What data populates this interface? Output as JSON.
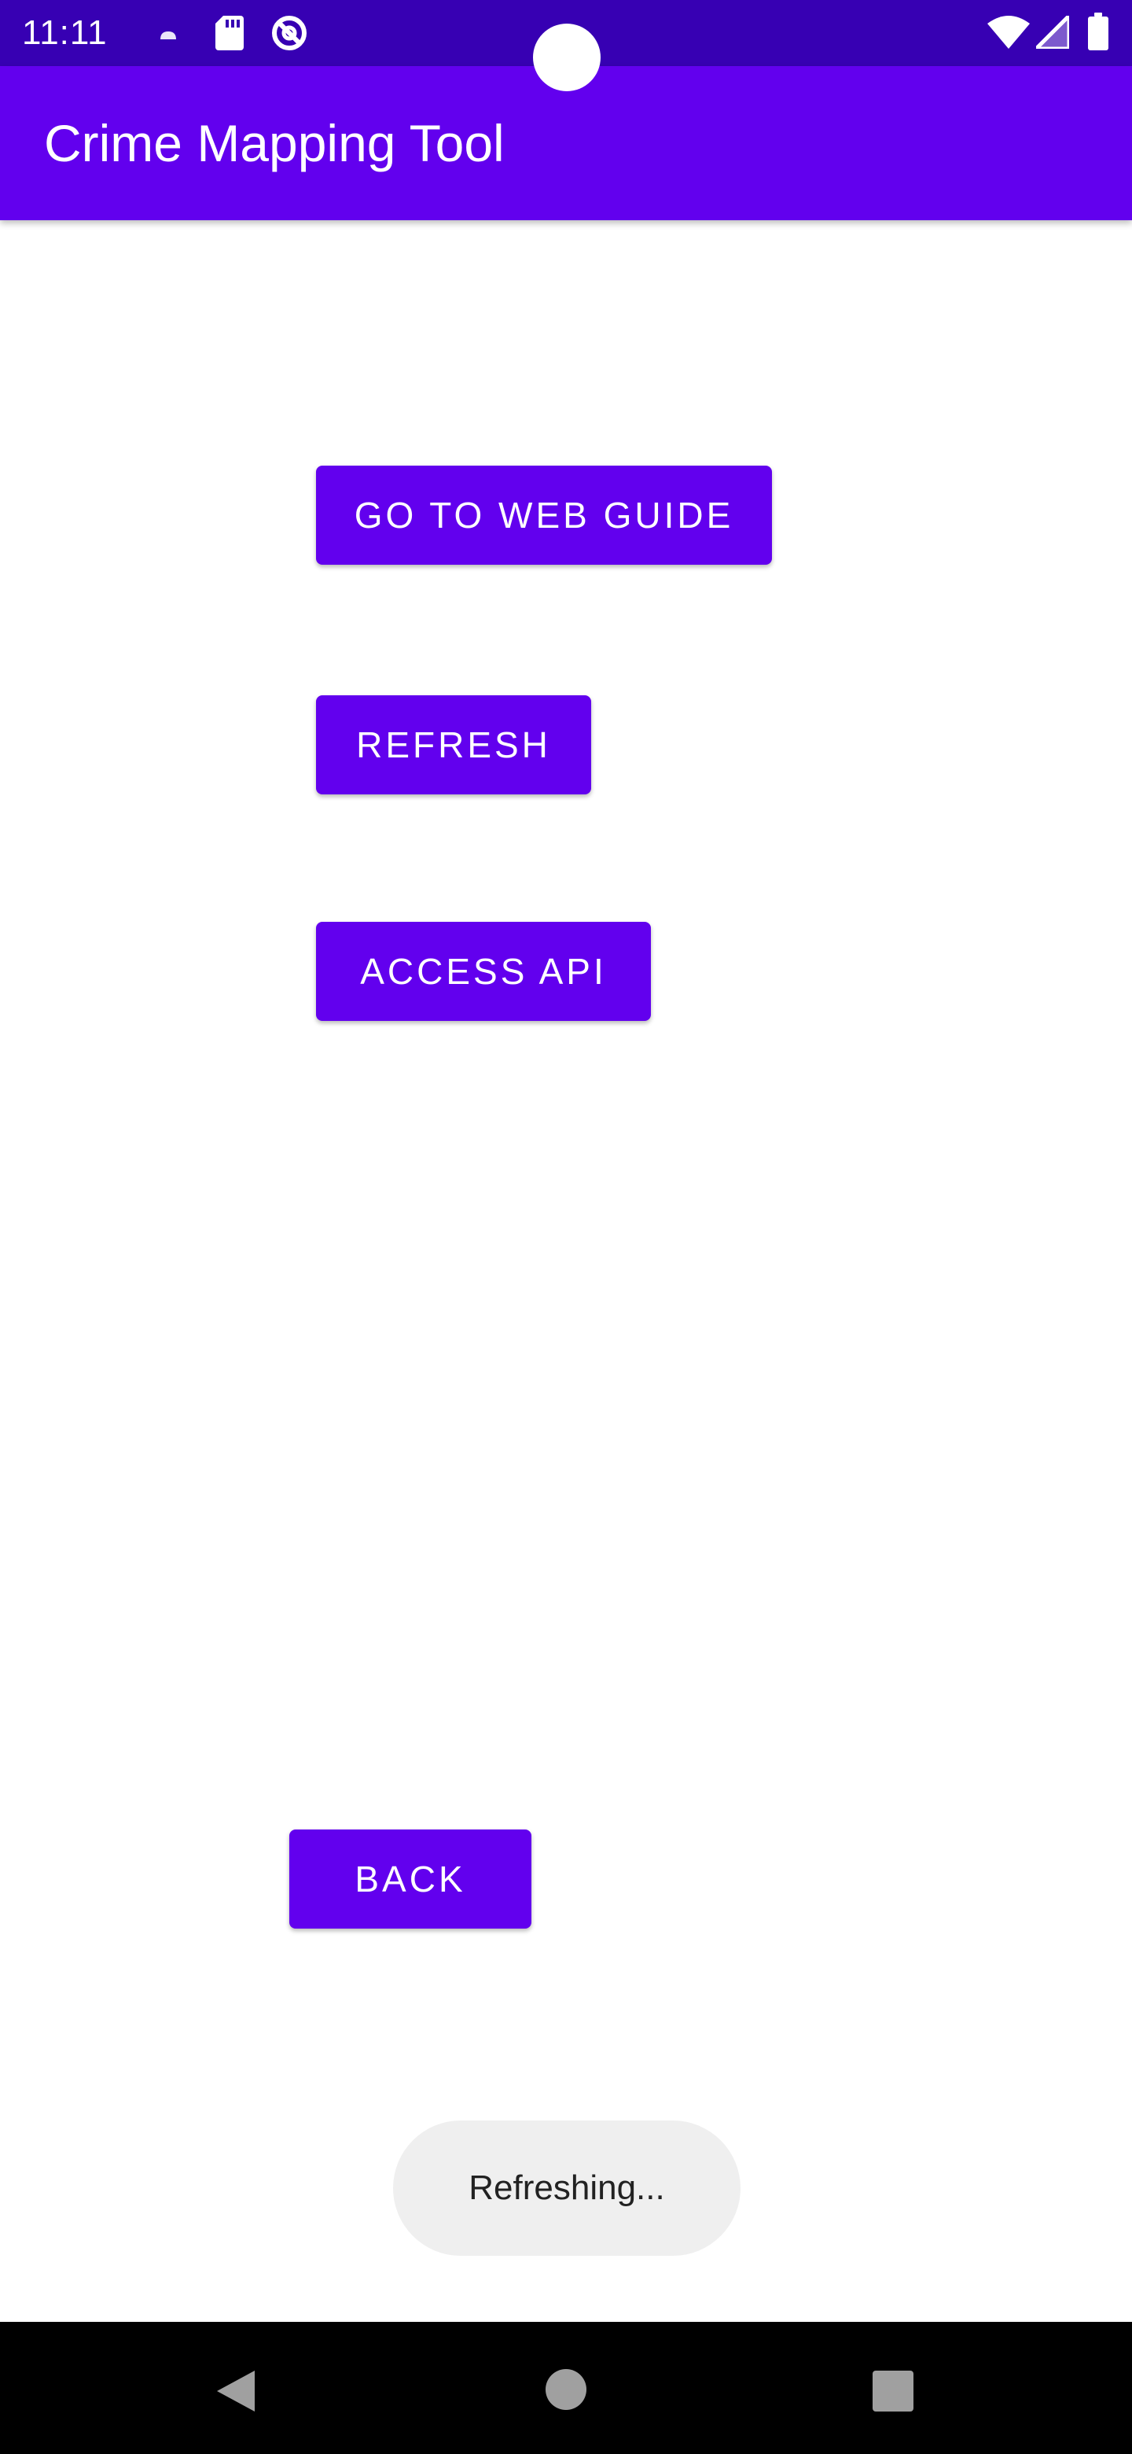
{
  "status_bar": {
    "time": "11:11",
    "left_icons": [
      "cloud-notification-icon",
      "sd-card-icon",
      "do-not-disturb-icon"
    ],
    "right_icons": [
      "wifi-icon",
      "cell-signal-icon",
      "battery-icon"
    ]
  },
  "app_bar": {
    "title": "Crime Mapping Tool"
  },
  "buttons": {
    "web_guide": "GO TO WEB GUIDE",
    "refresh": "REFRESH",
    "access_api": "ACCESS API",
    "back": "BACK"
  },
  "toast": {
    "message": "Refreshing..."
  },
  "nav_bar": {
    "icons": [
      "back-icon",
      "home-icon",
      "recents-icon"
    ]
  },
  "colors": {
    "status_bar": "#3700b3",
    "primary": "#6200ee",
    "toast_bg": "#efefef",
    "nav_bar": "#000000"
  }
}
